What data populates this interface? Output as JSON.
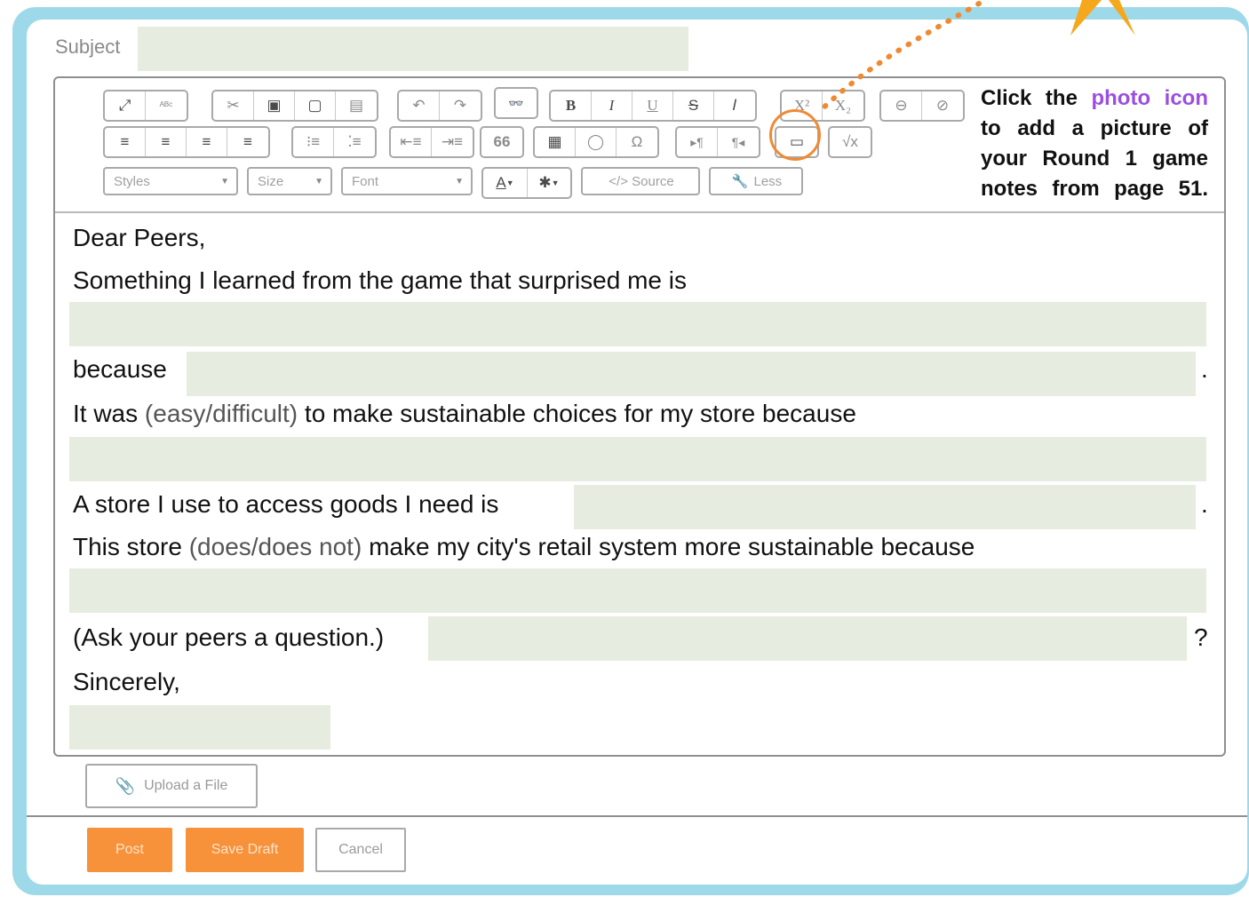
{
  "subject": {
    "label": "Subject",
    "value": ""
  },
  "toolbar": {
    "row1": [
      [
        "⤢",
        "ᴬᴮᶜ"
      ],
      [
        "✂",
        "▣",
        "▢",
        "▤"
      ],
      [
        "↶",
        "↷"
      ],
      [
        "👓"
      ],
      [
        "B",
        "I",
        "U",
        "S",
        "𝐼"
      ],
      [
        "X²",
        "X₂"
      ],
      [
        "⊖",
        "⊘"
      ]
    ],
    "row2": [
      [
        "≡",
        "≡",
        "≡",
        "≡"
      ],
      [
        "⁝≡",
        "⁚≡"
      ],
      [
        "⇤≡",
        "⇥≡"
      ],
      [
        "66"
      ],
      [
        "▦",
        "◯",
        "Ω"
      ],
      [
        "▸¶",
        "¶◂"
      ],
      [
        "▭"
      ],
      [
        "√x"
      ]
    ],
    "styles_label": "Styles",
    "size_label": "Size",
    "font_label": "Font",
    "color_a": "A",
    "color_bg": "✱",
    "source_label": "</> Source",
    "less_label": "Less",
    "accent_color": "#f08a32"
  },
  "callout": {
    "pre": "Click the",
    "highlight": "photo icon",
    "post": "to add a picture of your Round 1 game notes from page 51."
  },
  "letter": {
    "greeting": "Dear Peers,",
    "line1": "Something I learned from the game that surprised me is",
    "because": "because",
    "period1": ".",
    "line3_pre": "It was",
    "line3_opt": "(easy/difficult)",
    "line3_post": "to make sustainable choices for my store because",
    "line4": "A store I use to access goods I need is",
    "period2": ".",
    "line5_pre": "This store",
    "line5_opt": "(does/does not)",
    "line5_post": "make my city's retail system more sustainable because",
    "question_prompt": "(Ask your peers a question.)",
    "question_mark": "?",
    "closing": "Sincerely,"
  },
  "upload_label": "Upload a File",
  "buttons": {
    "post": "Post",
    "save_draft": "Save Draft",
    "cancel": "Cancel"
  }
}
